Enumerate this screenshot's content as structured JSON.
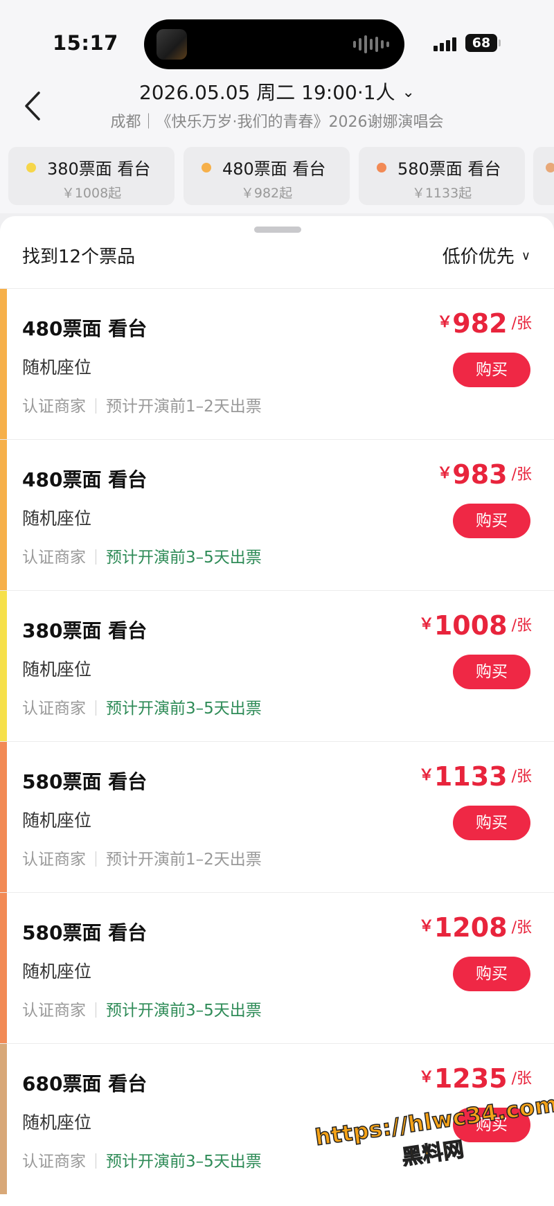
{
  "status_bar": {
    "time": "15:17",
    "battery": "68"
  },
  "header": {
    "date_line": "2026.05.05 周二 19:00·1人",
    "sub_line": "成都｜《快乐万岁·我们的青春》2026谢娜演唱会"
  },
  "tiers": [
    {
      "label": "380票面 看台",
      "price": "￥1008起",
      "color": "#f6d64a"
    },
    {
      "label": "480票面 看台",
      "price": "￥982起",
      "color": "#f6b04a"
    },
    {
      "label": "580票面 看台",
      "price": "￥1133起",
      "color": "#f28a55"
    }
  ],
  "list_header": {
    "count_text": "找到12个票品",
    "sort_label": "低价优先"
  },
  "listings": [
    {
      "title": "480票面 看台",
      "seat": "随机座位",
      "merchant": "认证商家",
      "eta": "预计开演前1–2天出票",
      "eta_green": false,
      "price": "982",
      "currency": "￥",
      "unit": "/张",
      "buy": "购买",
      "stripe": "#f6b04a"
    },
    {
      "title": "480票面 看台",
      "seat": "随机座位",
      "merchant": "认证商家",
      "eta": "预计开演前3–5天出票",
      "eta_green": true,
      "price": "983",
      "currency": "￥",
      "unit": "/张",
      "buy": "购买",
      "stripe": "#f6b04a"
    },
    {
      "title": "380票面 看台",
      "seat": "随机座位",
      "merchant": "认证商家",
      "eta": "预计开演前3–5天出票",
      "eta_green": true,
      "price": "1008",
      "currency": "￥",
      "unit": "/张",
      "buy": "购买",
      "stripe": "#f6e04a"
    },
    {
      "title": "580票面 看台",
      "seat": "随机座位",
      "merchant": "认证商家",
      "eta": "预计开演前1–2天出票",
      "eta_green": false,
      "price": "1133",
      "currency": "￥",
      "unit": "/张",
      "buy": "购买",
      "stripe": "#f28a55"
    },
    {
      "title": "580票面 看台",
      "seat": "随机座位",
      "merchant": "认证商家",
      "eta": "预计开演前3–5天出票",
      "eta_green": true,
      "price": "1208",
      "currency": "￥",
      "unit": "/张",
      "buy": "购买",
      "stripe": "#f28a55"
    },
    {
      "title": "680票面 看台",
      "seat": "随机座位",
      "merchant": "认证商家",
      "eta": "预计开演前3–5天出票",
      "eta_green": true,
      "price": "1235",
      "currency": "￥",
      "unit": "/张",
      "buy": "购买",
      "stripe": "#d8a878"
    }
  ],
  "watermark": {
    "url": "https://hlwc34.com",
    "name": "黑料网"
  }
}
